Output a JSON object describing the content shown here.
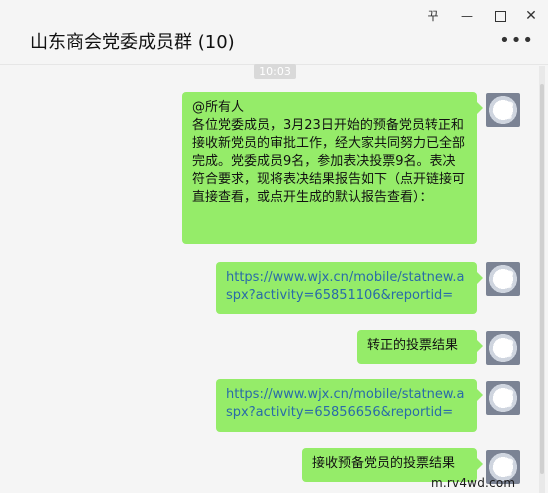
{
  "window": {
    "title": "山东商会党委成员群 (10)",
    "controls": {
      "pin": "꾸",
      "minimize": "—",
      "close": "✕",
      "more": "•••"
    }
  },
  "chat": {
    "time": "10:03",
    "messages": [
      {
        "text": "@所有人\n各位党委成员，3月23日开始的预备党员转正和接收新党员的审批工作，经大家共同努力已全部完成。党委成员9名，参加表决投票9名。表决符合要求，现将表决结果报告如下（点开链接可直接查看，或点开生成的默认报告查看）："
      },
      {
        "text": "https://www.wjx.cn/mobile/statnew.aspx?activity=65851106&reportid=",
        "is_link": true
      },
      {
        "text": "转正的投票结果"
      },
      {
        "text": "https://www.wjx.cn/mobile/statnew.aspx?activity=65856656&reportid=",
        "is_link": true
      },
      {
        "text": "接收预备党员的投票结果"
      }
    ]
  },
  "watermark": "m.rv4wd.com"
}
